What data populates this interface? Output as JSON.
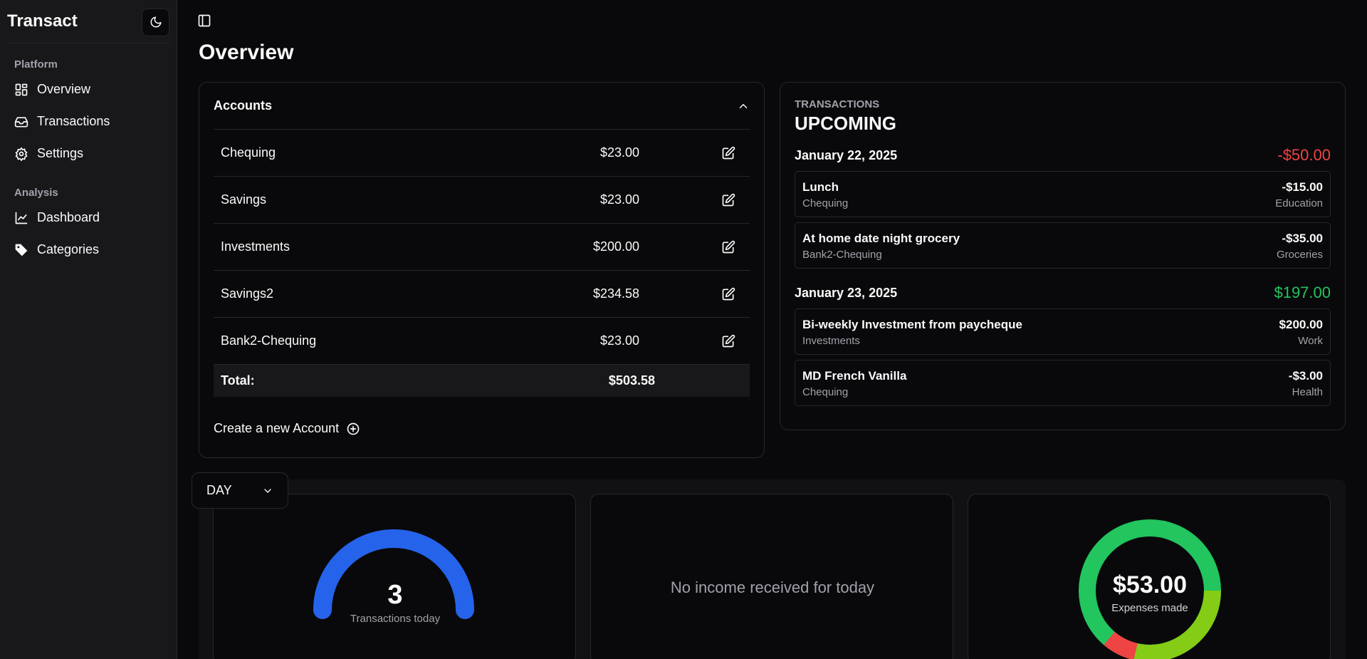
{
  "app": {
    "title": "Transact"
  },
  "sidebar": {
    "groups": [
      {
        "label": "Platform",
        "items": [
          {
            "label": "Overview"
          },
          {
            "label": "Transactions"
          },
          {
            "label": "Settings"
          }
        ]
      },
      {
        "label": "Analysis",
        "items": [
          {
            "label": "Dashboard"
          },
          {
            "label": "Categories"
          }
        ]
      }
    ]
  },
  "page": {
    "title": "Overview"
  },
  "accounts": {
    "title": "Accounts",
    "rows": [
      {
        "name": "Chequing",
        "amount": "$23.00"
      },
      {
        "name": "Savings",
        "amount": "$23.00"
      },
      {
        "name": "Investments",
        "amount": "$200.00"
      },
      {
        "name": "Savings2",
        "amount": "$234.58"
      },
      {
        "name": "Bank2-Chequing",
        "amount": "$23.00"
      }
    ],
    "total_label": "Total:",
    "total_amount": "$503.58",
    "create_label": "Create a new Account"
  },
  "upcoming": {
    "kicker": "TRANSACTIONS",
    "title": "UPCOMING",
    "days": [
      {
        "date": "January 22, 2025",
        "total": "-$50.00",
        "items": [
          {
            "name": "Lunch",
            "account": "Chequing",
            "amount": "-$15.00",
            "category": "Education"
          },
          {
            "name": "At home date night grocery",
            "account": "Bank2-Chequing",
            "amount": "-$35.00",
            "category": "Groceries"
          }
        ]
      },
      {
        "date": "January 23, 2025",
        "total": "$197.00",
        "items": [
          {
            "name": "Bi-weekly Investment from paycheque",
            "account": "Investments",
            "amount": "$200.00",
            "category": "Work"
          },
          {
            "name": "MD French Vanilla",
            "account": "Chequing",
            "amount": "-$3.00",
            "category": "Health"
          }
        ]
      }
    ]
  },
  "stats": {
    "period": "DAY",
    "transactions_count": "3",
    "transactions_caption": "Transactions today",
    "income_empty": "No income received for today",
    "expenses_total": "$53.00",
    "expenses_caption": "Expenses made"
  },
  "colors": {
    "accent_blue": "#2563eb",
    "negative": "#ef4444",
    "positive": "#22c55e",
    "donut": [
      "#22c55e",
      "#84cc16",
      "#ef4444"
    ]
  },
  "icons": {
    "theme": "moon-icon",
    "panel": "sidebar-toggle-icon",
    "edit": "edit-icon",
    "collapse": "chevron-up-icon",
    "add": "plus-circle-icon",
    "dropdown": "chevron-down-icon"
  }
}
